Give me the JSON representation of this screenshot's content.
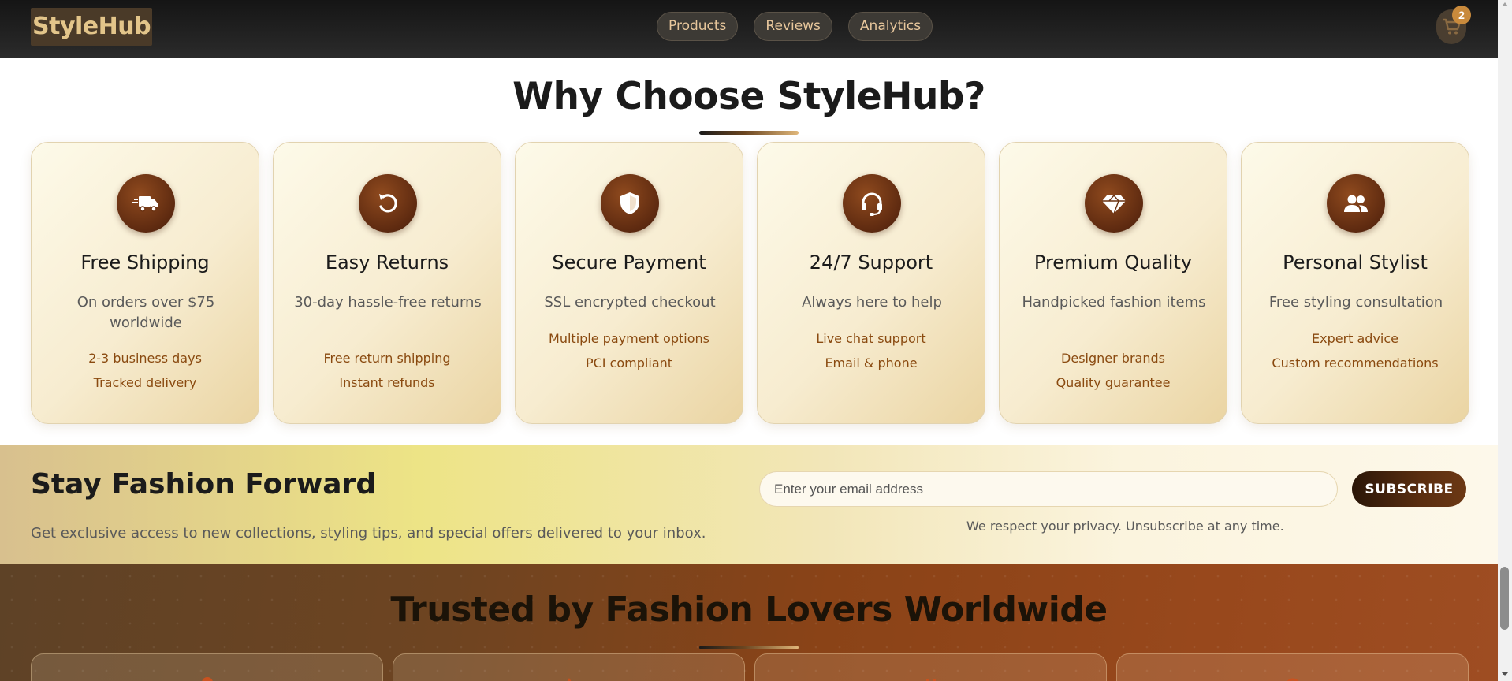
{
  "header": {
    "logo": "StyleHub",
    "nav": [
      "Products",
      "Reviews",
      "Analytics"
    ],
    "cart_icon": "cart-icon",
    "cart_count": "2"
  },
  "why": {
    "title": "Why Choose StyleHub?",
    "cards": [
      {
        "icon": "truck-icon",
        "title": "Free Shipping",
        "desc": "On orders over $75 worldwide",
        "features": [
          "2-3 business days",
          "Tracked delivery"
        ]
      },
      {
        "icon": "undo-icon",
        "title": "Easy Returns",
        "desc": "30-day hassle-free returns",
        "features": [
          "Free return shipping",
          "Instant refunds"
        ]
      },
      {
        "icon": "shield-icon",
        "title": "Secure Payment",
        "desc": "SSL encrypted checkout",
        "features": [
          "Multiple payment options",
          "PCI compliant"
        ]
      },
      {
        "icon": "headset-icon",
        "title": "24/7 Support",
        "desc": "Always here to help",
        "features": [
          "Live chat support",
          "Email & phone"
        ]
      },
      {
        "icon": "gem-icon",
        "title": "Premium Quality",
        "desc": "Handpicked fashion items",
        "features": [
          "Designer brands",
          "Quality guarantee"
        ]
      },
      {
        "icon": "users-icon",
        "title": "Personal Stylist",
        "desc": "Free styling consultation",
        "features": [
          "Expert advice",
          "Custom recommendations"
        ]
      }
    ]
  },
  "newsletter": {
    "title": "Stay Fashion Forward",
    "subtitle": "Get exclusive access to new collections, styling tips, and special offers delivered to your inbox.",
    "email_placeholder": "Enter your email address",
    "button": "SUBSCRIBE",
    "privacy": "We respect your privacy. Unsubscribe at any time."
  },
  "trusted": {
    "title": "Trusted by Fashion Lovers Worldwide"
  },
  "colors": {
    "accent_dark": "#5e2a10",
    "accent_gold": "#e0b77a",
    "feature_text": "#8a4a10"
  }
}
